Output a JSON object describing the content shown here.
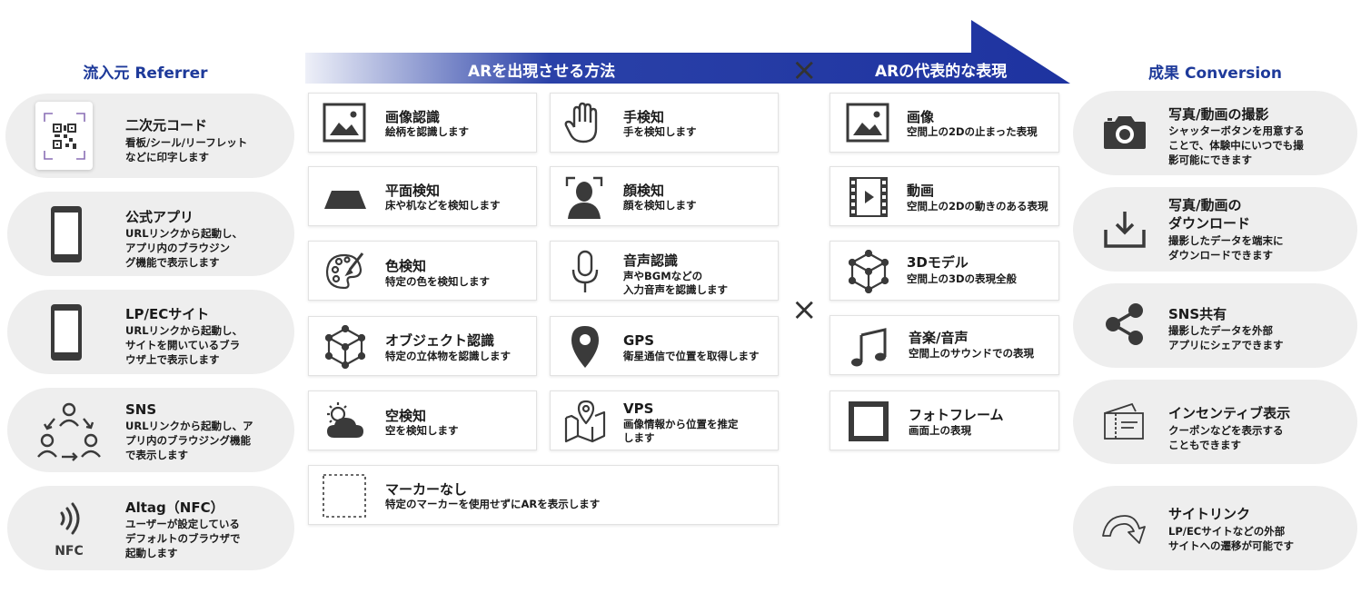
{
  "columns": {
    "referrer_title": "流入元 Referrer",
    "method_title": "ARを出現させる方法",
    "expression_title": "ARの代表的な表現",
    "conversion_title": "成果 Conversion",
    "times_symbol": "×"
  },
  "referrer": [
    {
      "icon": "qr-code-icon",
      "title": "二次元コード",
      "desc": [
        "看板/シール/リーフレット",
        "などに印字します"
      ]
    },
    {
      "icon": "smartphone-icon",
      "title": "公式アプリ",
      "desc": [
        "URLリンクから起動し、",
        "アプリ内のブラウジン",
        "グ機能で表示します"
      ]
    },
    {
      "icon": "smartphone-icon",
      "title": "LP/ECサイト",
      "desc": [
        "URLリンクから起動し、",
        "サイトを開いているブラ",
        "ウザ上で表示します"
      ]
    },
    {
      "icon": "people-cycle-icon",
      "title": "SNS",
      "desc": [
        "URLリンクから起動し、ア",
        "プリ内のブラウジング機能",
        "で表示します"
      ]
    },
    {
      "icon": "nfc-icon",
      "icon_label": "NFC",
      "title": "Altag（NFC）",
      "desc": [
        "ユーザーが設定している",
        "デフォルトのブラウザで",
        "起動します"
      ]
    }
  ],
  "methods": [
    {
      "icon": "image-icon",
      "title": "画像認識",
      "desc": [
        "絵柄を認識します"
      ]
    },
    {
      "icon": "hand-icon",
      "title": "手検知",
      "desc": [
        "手を検知します"
      ]
    },
    {
      "icon": "plane-icon",
      "title": "平面検知",
      "desc": [
        "床や机などを検知します"
      ]
    },
    {
      "icon": "face-icon",
      "title": "顔検知",
      "desc": [
        "顔を検知します"
      ]
    },
    {
      "icon": "palette-icon",
      "title": "色検知",
      "desc": [
        "特定の色を検知します"
      ]
    },
    {
      "icon": "microphone-icon",
      "title": "音声認識",
      "desc": [
        "声やBGMなどの",
        "入力音声を認識します"
      ]
    },
    {
      "icon": "cube-icon",
      "title": "オブジェクト認識",
      "desc": [
        "特定の立体物を認識します"
      ]
    },
    {
      "icon": "map-pin-icon",
      "title": "GPS",
      "desc": [
        "衛星通信で位置を取得します"
      ]
    },
    {
      "icon": "weather-icon",
      "title": "空検知",
      "desc": [
        "空を検知します"
      ]
    },
    {
      "icon": "map-icon",
      "title": "VPS",
      "desc": [
        "画像情報から位置を推定",
        "します"
      ]
    },
    {
      "icon": "dotted-square-icon",
      "title": "マーカーなし",
      "desc": [
        "特定のマーカーを使用せずにARを表示します"
      ]
    }
  ],
  "expressions": [
    {
      "icon": "image-icon",
      "title": "画像",
      "desc": [
        "空間上の2Dの止まった表現"
      ]
    },
    {
      "icon": "video-icon",
      "title": "動画",
      "desc": [
        "空間上の2Dの動きのある表現"
      ]
    },
    {
      "icon": "cube-icon",
      "title": "3Dモデル",
      "desc": [
        "空間上の3Dの表現全般"
      ]
    },
    {
      "icon": "music-note-icon",
      "title": "音楽/音声",
      "desc": [
        "空間上のサウンドでの表現"
      ]
    },
    {
      "icon": "frame-icon",
      "title": "フォトフレーム",
      "desc": [
        "画面上の表現"
      ]
    }
  ],
  "conversions": [
    {
      "icon": "camera-icon",
      "title": [
        "写真/動画の撮影"
      ],
      "desc": [
        "シャッターボタンを用意する",
        "ことで、体験中にいつでも撮",
        "影可能にできます"
      ]
    },
    {
      "icon": "download-icon",
      "title": [
        "写真/動画の",
        "ダウンロード"
      ],
      "desc": [
        "撮影したデータを端末に",
        "ダウンロードできます"
      ]
    },
    {
      "icon": "share-icon",
      "title": [
        "SNS共有"
      ],
      "desc": [
        "撮影したデータを外部",
        "アプリにシェアできます"
      ]
    },
    {
      "icon": "coupon-icon",
      "title": [
        "インセンティブ表示"
      ],
      "desc": [
        "クーポンなどを表示する",
        "こともできます"
      ]
    },
    {
      "icon": "redirect-arrow-icon",
      "title": [
        "サイトリンク"
      ],
      "desc": [
        "LP/ECサイトなどの外部",
        "サイトへの遷移が可能です"
      ]
    }
  ],
  "colors": {
    "accent": "#1e3a9a",
    "ribbon_start": "#e9ecf6",
    "ribbon_end": "#1f35a3",
    "icon": "#3a3a3a",
    "pill_bg": "#eeeeee"
  }
}
